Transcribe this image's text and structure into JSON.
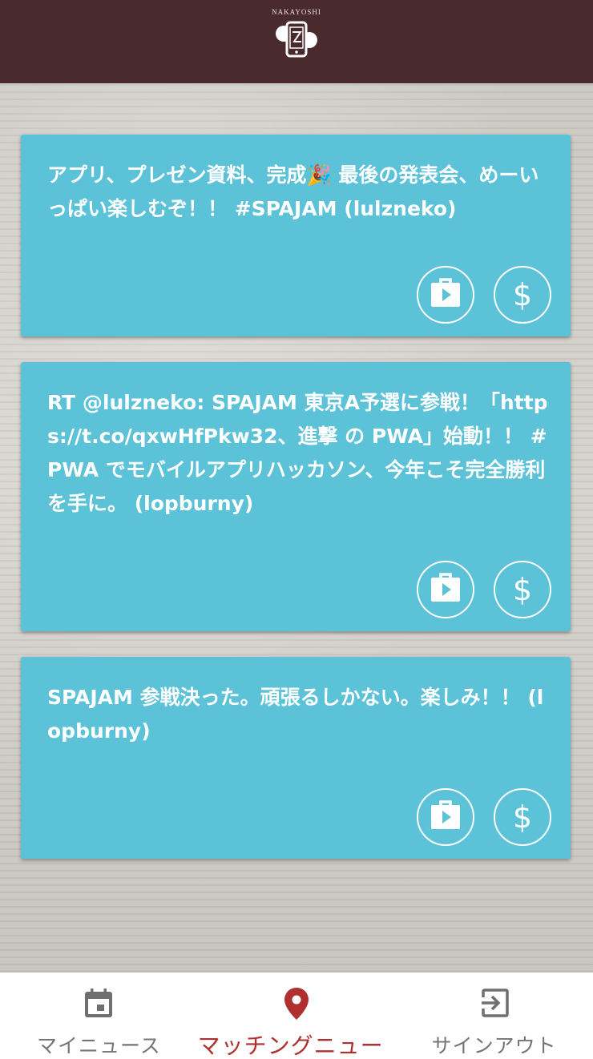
{
  "header": {
    "logo_text": "NAKAYOSHI"
  },
  "cards": [
    {
      "text": "アプリ、プレゼン資料、完成🎉 最後の発表会、めーいっぱい楽しむぞ！！ #SPAJAM (lulzneko)",
      "actions": [
        "play-store-icon",
        "dollar-icon"
      ]
    },
    {
      "text": "RT @lulzneko: SPAJAM 東京A予選に参戦！「https://t.co/qxwHfPkw32、進撃 の PWA」始動！！ #PWA でモバイルアプリハッカソン、今年こそ完全勝利を手に。 (lopburny)",
      "actions": [
        "play-store-icon",
        "dollar-icon"
      ]
    },
    {
      "text": "SPAJAM 参戦決った。頑張るしかない。楽しみ！！ (lopburny)",
      "actions": [
        "play-store-icon",
        "dollar-icon"
      ]
    }
  ],
  "bottom_nav": {
    "items": [
      {
        "label": "マイニュース",
        "icon": "calendar-icon",
        "active": false
      },
      {
        "label": "マッチングニュース",
        "icon": "location-pin-icon",
        "active": true
      },
      {
        "label": "サインアウト",
        "icon": "exit-icon",
        "active": false
      }
    ]
  },
  "colors": {
    "header_bg": "#4a2b2d",
    "card_bg": "#5bc2d8",
    "active_nav": "#b03030",
    "inactive_nav": "#757575"
  }
}
